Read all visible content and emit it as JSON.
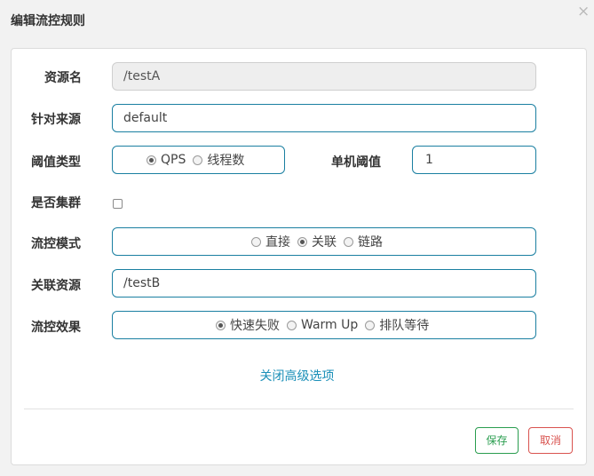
{
  "dialog": {
    "title": "编辑流控规则",
    "close_glyph": "×"
  },
  "form": {
    "resource_name": {
      "label": "资源名",
      "value": "/testA"
    },
    "limit_app": {
      "label": "针对来源",
      "value": "default"
    },
    "grade": {
      "label": "阈值类型",
      "options": [
        "QPS",
        "线程数"
      ],
      "selected": "QPS"
    },
    "count": {
      "label": "单机阈值",
      "value": "1"
    },
    "cluster": {
      "label": "是否集群",
      "checked": false
    },
    "strategy": {
      "label": "流控模式",
      "options": [
        "直接",
        "关联",
        "链路"
      ],
      "selected": "关联"
    },
    "ref_resource": {
      "label": "关联资源",
      "value": "/testB"
    },
    "control_behavior": {
      "label": "流控效果",
      "options": [
        "快速失败",
        "Warm Up",
        "排队等待"
      ],
      "selected": "快速失败"
    },
    "advanced_toggle": "关闭高级选项"
  },
  "footer": {
    "save_label": "保存",
    "cancel_label": "取消"
  },
  "colors": {
    "accent": "#1a7fa1",
    "save": "#2a9d4f",
    "cancel": "#d9534f"
  }
}
